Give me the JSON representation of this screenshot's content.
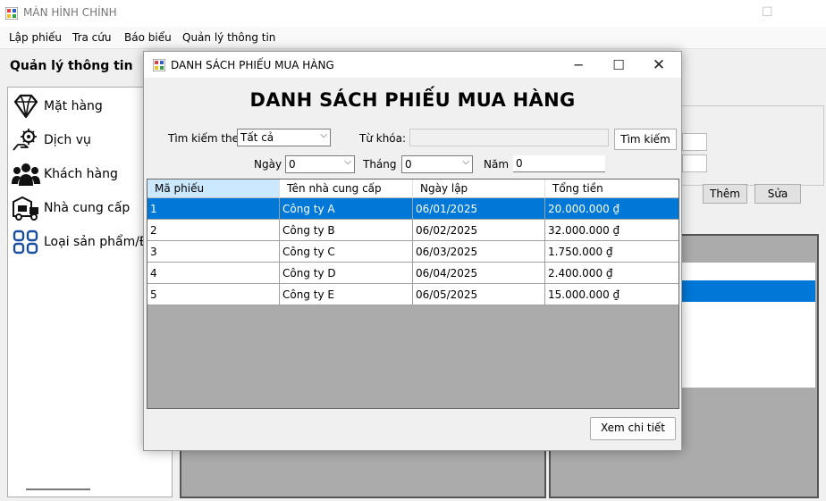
{
  "main_window": {
    "title": "MÀN HÌNH CHÍNH",
    "menu": [
      "Lập phiếu",
      "Tra cứu",
      "Báo biểu",
      "Quản lý thông tin"
    ],
    "sidebar_title": "Quản lý thông tin",
    "sidebar_items": [
      {
        "label": "Mặt hàng",
        "icon": "diamond-icon"
      },
      {
        "label": "Dịch vụ",
        "icon": "gear-hand-icon"
      },
      {
        "label": "Khách hàng",
        "icon": "people-icon"
      },
      {
        "label": "Nhà cung cấp",
        "icon": "truck-icon"
      },
      {
        "label": "Loại sản phẩm/Đơ",
        "icon": "grid-icon"
      }
    ],
    "buttons": {
      "add": "Thêm",
      "edit": "Sửa"
    }
  },
  "dialog": {
    "title": "DANH SÁCH PHIẾU MUA HÀNG",
    "heading": "DANH SÁCH PHIẾU MUA HÀNG",
    "search_by_label": "Tìm kiếm theo:",
    "search_by_value": "Tất cả",
    "keyword_label": "Từ khóa:",
    "keyword_value": "",
    "search_button": "Tìm kiếm",
    "day_label": "Ngày",
    "day_value": "0",
    "month_label": "Tháng",
    "month_value": "0",
    "year_label": "Năm",
    "year_value": "0",
    "columns": [
      "Mã phiếu",
      "Tên nhà cung cấp",
      "Ngày lập",
      "Tổng tiền"
    ],
    "rows": [
      [
        "1",
        "Công ty A",
        "06/01/2025",
        "20.000.000 ₫"
      ],
      [
        "2",
        "Công ty B",
        "06/02/2025",
        "32.000.000 ₫"
      ],
      [
        "3",
        "Công ty C",
        "06/03/2025",
        "1.750.000 ₫"
      ],
      [
        "4",
        "Công ty D",
        "06/04/2025",
        "2.400.000 ₫"
      ],
      [
        "5",
        "Công ty E",
        "06/05/2025",
        "15.000.000 ₫"
      ]
    ],
    "selected_row": 0,
    "detail_button": "Xem chi tiết"
  },
  "colors": {
    "selection": "#0078d7",
    "header_selected": "#cce8ff",
    "grid_background": "#ababab"
  }
}
